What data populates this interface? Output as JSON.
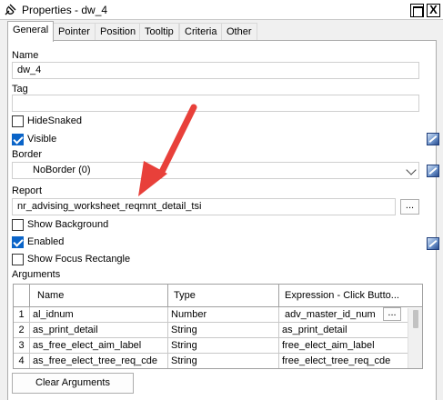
{
  "window": {
    "title": "Properties - dw_4",
    "icon": "properties-pin-icon",
    "buttons": [
      "maximize-icon",
      "close-icon"
    ],
    "close_glyph": "X"
  },
  "tabs": [
    "General",
    "Pointer",
    "Position",
    "Tooltip",
    "Criteria",
    "Other"
  ],
  "active_tab": "General",
  "name": {
    "label": "Name",
    "value": "dw_4"
  },
  "tag": {
    "label": "Tag",
    "value": ""
  },
  "hide_snaked": {
    "label": "HideSnaked",
    "checked": false
  },
  "visible": {
    "label": "Visible",
    "checked": true
  },
  "border": {
    "label": "Border",
    "value": "NoBorder (0)"
  },
  "report": {
    "label": "Report",
    "value": "nr_advising_worksheet_reqmnt_detail_tsi",
    "browse": "..."
  },
  "show_background": {
    "label": "Show Background",
    "checked": false
  },
  "enabled": {
    "label": "Enabled",
    "checked": true
  },
  "show_focus_rectangle": {
    "label": "Show Focus Rectangle",
    "checked": false
  },
  "arguments": {
    "label": "Arguments",
    "columns": [
      "Name",
      "Type",
      "Expression - Click Butto..."
    ],
    "rows": [
      {
        "num": "1",
        "name": "al_idnum",
        "type": "Number",
        "expression": "adv_master_id_num",
        "button": "..."
      },
      {
        "num": "2",
        "name": "as_print_detail",
        "type": "String",
        "expression": "as_print_detail"
      },
      {
        "num": "3",
        "name": "as_free_elect_aim_label",
        "type": "String",
        "expression": "free_elect_aim_label"
      },
      {
        "num": "4",
        "name": "as_free_elect_tree_req_cde",
        "type": "String",
        "expression": "free_elect_tree_req_cde"
      }
    ]
  },
  "clear_arguments": "Clear Arguments",
  "annotation": {
    "color": "#e8403a"
  }
}
